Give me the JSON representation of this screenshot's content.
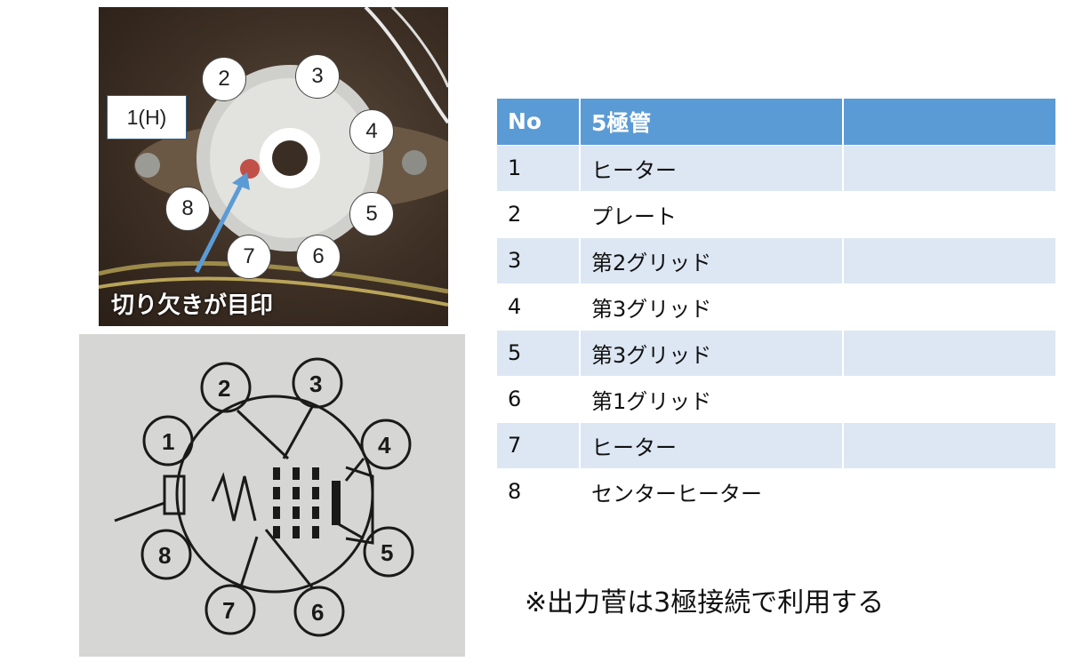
{
  "photo": {
    "pins": [
      {
        "label": "2"
      },
      {
        "label": "3"
      },
      {
        "label": "4"
      },
      {
        "label": "5"
      },
      {
        "label": "6"
      },
      {
        "label": "7"
      },
      {
        "label": "8"
      }
    ],
    "heater_label": "1(H)",
    "notch_caption": "切り欠きが目印"
  },
  "diagram": {
    "pins": [
      "2",
      "3",
      "4",
      "5",
      "6",
      "7",
      "8",
      "1"
    ]
  },
  "table": {
    "headers": [
      "No",
      "5極管",
      ""
    ],
    "rows": [
      {
        "no": "1",
        "name": "ヒーター",
        "extra": ""
      },
      {
        "no": "2",
        "name": "プレート",
        "extra": ""
      },
      {
        "no": "3",
        "name": "第2グリッド",
        "extra": ""
      },
      {
        "no": "4",
        "name": "第3グリッド",
        "extra": ""
      },
      {
        "no": "5",
        "name": "第3グリッド",
        "extra": ""
      },
      {
        "no": "6",
        "name": "第1グリッド",
        "extra": ""
      },
      {
        "no": "7",
        "name": "ヒーター",
        "extra": ""
      },
      {
        "no": "8",
        "name": "センターヒーター",
        "extra": ""
      }
    ]
  },
  "note": "※出力菅は3極接続で利用する"
}
